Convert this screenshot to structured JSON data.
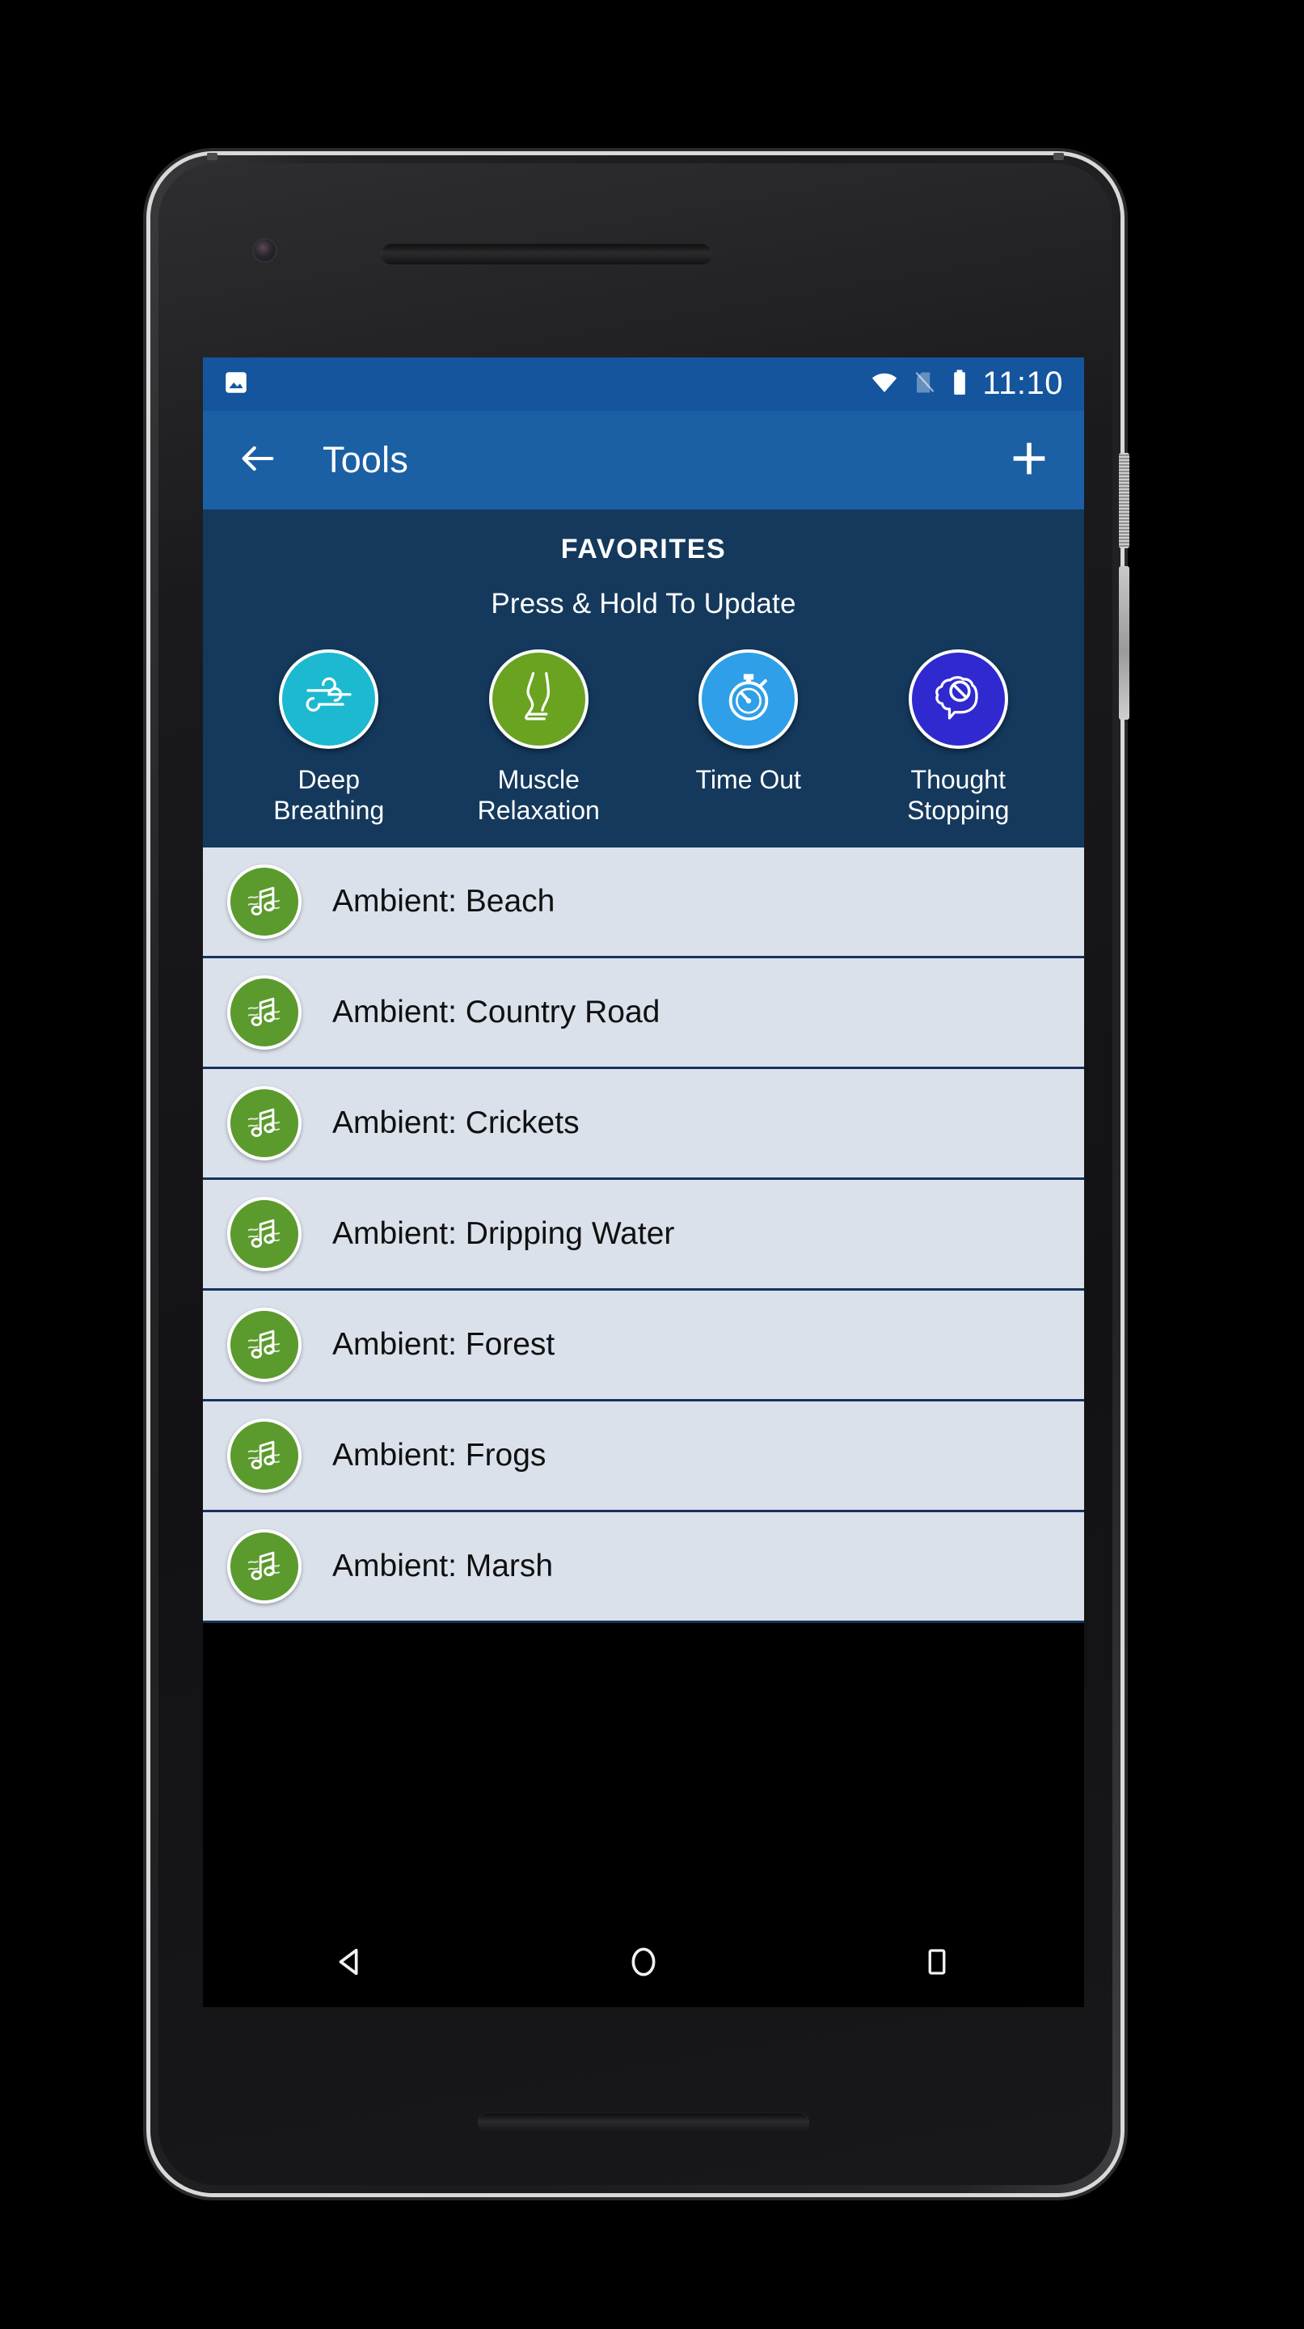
{
  "status_bar": {
    "notification_icon": "image-notification-icon",
    "wifi_icon": "wifi-icon",
    "sim_icon": "no-sim-icon",
    "battery_icon": "battery-full-icon",
    "clock": "11:10"
  },
  "app_bar": {
    "back_icon": "arrow-back-icon",
    "title": "Tools",
    "add_icon": "plus-icon"
  },
  "favorites": {
    "heading": "FAVORITES",
    "subheading": "Press & Hold To Update",
    "items": [
      {
        "label": "Deep\nBreathing",
        "icon": "wind-icon",
        "color": "#1cb9d0"
      },
      {
        "label": "Muscle\nRelaxation",
        "icon": "leg-icon",
        "color": "#6aa320"
      },
      {
        "label": "Time Out",
        "icon": "stopwatch-icon",
        "color": "#2e9fe8"
      },
      {
        "label": "Thought\nStopping",
        "icon": "brain-block-icon",
        "color": "#2f29cf"
      }
    ]
  },
  "tool_list": {
    "item_icon": "music-note-icon",
    "items": [
      {
        "label": "Ambient: Beach"
      },
      {
        "label": "Ambient: Country Road"
      },
      {
        "label": "Ambient: Crickets"
      },
      {
        "label": "Ambient: Dripping Water"
      },
      {
        "label": "Ambient: Forest"
      },
      {
        "label": "Ambient: Frogs"
      },
      {
        "label": "Ambient: Marsh"
      }
    ]
  },
  "nav_bar": {
    "back_icon": "nav-back-triangle-icon",
    "home_icon": "nav-home-circle-icon",
    "recents_icon": "nav-recents-square-icon"
  },
  "colors": {
    "status_bar": "#14559e",
    "app_bar": "#1b60a5",
    "favorites_bg": "#14395c",
    "list_row": "#dae1eb",
    "list_divider": "#16335c",
    "list_icon_green": "#5b9a2d"
  }
}
